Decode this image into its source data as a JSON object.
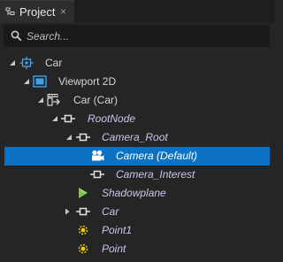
{
  "panel": {
    "tab_label": "Project",
    "tab_close": "×"
  },
  "search": {
    "placeholder": "Search..."
  },
  "tree": [
    {
      "label": "Car",
      "italic": false,
      "icon": "scene-icon",
      "expander": "expanded",
      "selected": false
    },
    {
      "label": "Viewport 2D",
      "italic": false,
      "icon": "viewport-2d-icon",
      "expander": "expanded",
      "selected": false
    },
    {
      "label": "Car (Car)",
      "italic": false,
      "icon": "prefab-instance-icon",
      "expander": "expanded",
      "selected": false
    },
    {
      "label": "RootNode",
      "italic": true,
      "icon": "node-icon",
      "expander": "expanded",
      "selected": false
    },
    {
      "label": "Camera_Root",
      "italic": true,
      "icon": "node-icon",
      "expander": "expanded",
      "selected": false
    },
    {
      "label": "Camera (Default)",
      "italic": true,
      "icon": "camera-icon",
      "expander": "none",
      "selected": true
    },
    {
      "label": "Camera_Interest",
      "italic": true,
      "icon": "node-icon",
      "expander": "none",
      "selected": false
    },
    {
      "label": "Shadowplane",
      "italic": true,
      "icon": "mesh-icon",
      "expander": "none",
      "selected": false
    },
    {
      "label": "Car",
      "italic": true,
      "icon": "node-icon",
      "expander": "collapsed",
      "selected": false
    },
    {
      "label": "Point1",
      "italic": true,
      "icon": "point-light-icon",
      "expander": "none",
      "selected": false
    },
    {
      "label": "Point",
      "italic": true,
      "icon": "point-light-icon",
      "expander": "none",
      "selected": false
    }
  ],
  "colors": {
    "background": "#252526",
    "selection": "#0b72c4",
    "italic_node_text": "#c7c7ec",
    "regular_text": "#d6d6d6",
    "selected_text": "#ffffff"
  }
}
